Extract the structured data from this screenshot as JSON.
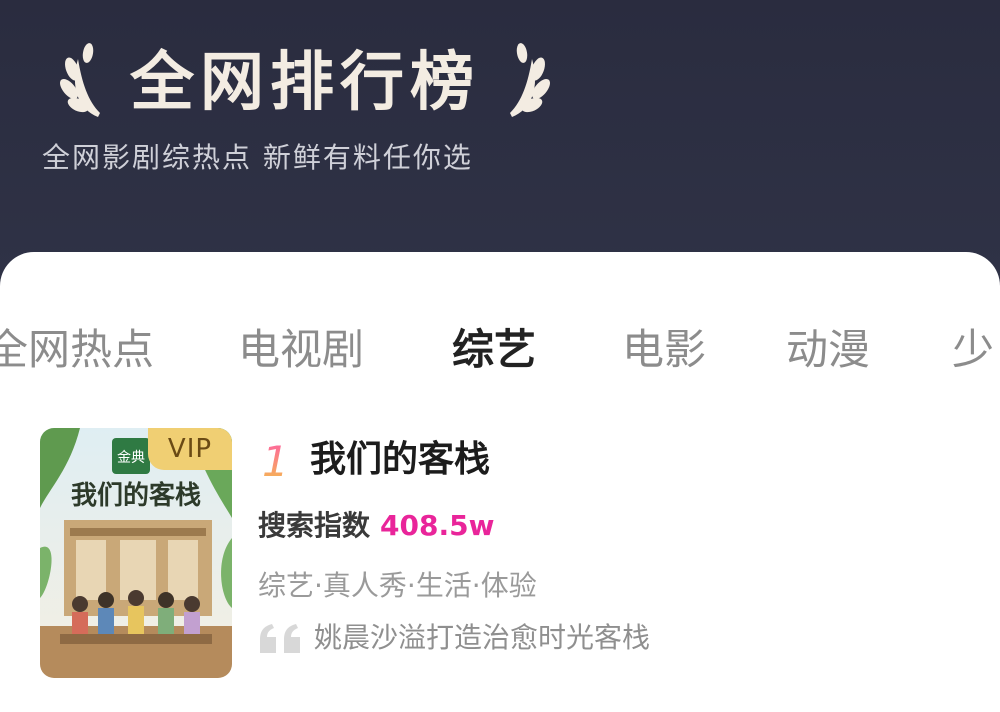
{
  "header": {
    "title": "全网排行榜",
    "subtitle": "全网影剧综热点  新鲜有料任你选"
  },
  "tabs": [
    {
      "label": "全网热点",
      "active": false
    },
    {
      "label": "电视剧",
      "active": false
    },
    {
      "label": "综艺",
      "active": true
    },
    {
      "label": "电影",
      "active": false
    },
    {
      "label": "动漫",
      "active": false
    },
    {
      "label": "少",
      "active": false
    }
  ],
  "item": {
    "rank": "1",
    "title": "我们的客栈",
    "badge": "VIP",
    "search_label": "搜索指数",
    "search_value": "408.5w",
    "tags": "综艺·真人秀·生活·体验",
    "description": "姚晨沙溢打造治愈时光客栈",
    "poster_logo_text": "我们的客栈",
    "poster_brand_text": "金典"
  },
  "colors": {
    "header_bg": "#2b2d40",
    "title_text": "#f3ece2",
    "accent_pink": "#e9259a",
    "vip_gold": "#f0cf73"
  }
}
